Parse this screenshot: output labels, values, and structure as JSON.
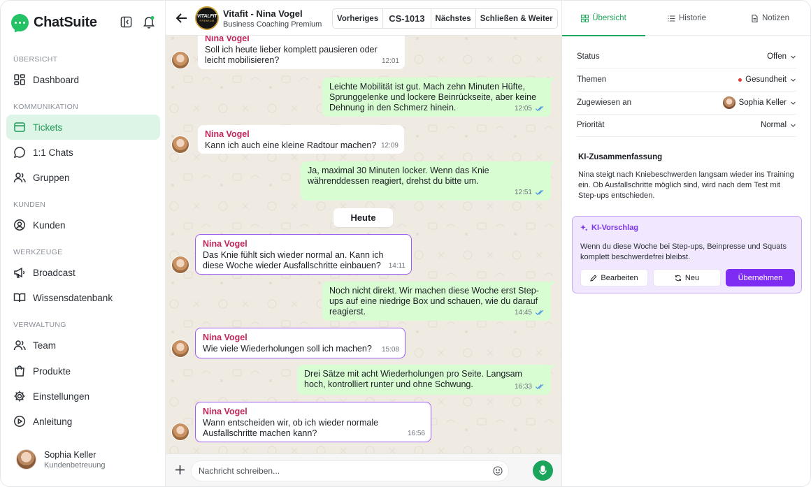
{
  "sidebar": {
    "brand": "ChatSuite",
    "sections": {
      "overview": "ÜBERSICHT",
      "communication": "KOMMUNIKATION",
      "customers": "KUNDEN",
      "tools": "WERKZEUGE",
      "admin": "VERWALTUNG"
    },
    "items": {
      "dashboard": "Dashboard",
      "tickets": "Tickets",
      "chats": "1:1 Chats",
      "groups": "Gruppen",
      "customers": "Kunden",
      "broadcast": "Broadcast",
      "knowledge": "Wissensdatenbank",
      "team": "Team",
      "products": "Produkte",
      "settings": "Einstellungen",
      "guide": "Anleitung"
    },
    "active_item": "tickets",
    "user": {
      "name": "Sophia Keller",
      "role": "Kundenbetreuung"
    }
  },
  "chat": {
    "header": {
      "avatar_line1": "VITALFIT",
      "avatar_line2": "PREMIUM",
      "title": "Vitafit - Nina Vogel",
      "subtitle": "Business Coaching Premium",
      "prev": "Vorheriges",
      "ticket_id": "CS-1013",
      "next": "Nächstes",
      "close_next": "Schließen & Weiter"
    },
    "day_separator": "Heute",
    "messages": [
      {
        "dir": "in",
        "sender": "Nina Vogel",
        "text": "Soll ich heute lieber komplett pausieren oder leicht mobilisieren?",
        "time": "12:01"
      },
      {
        "dir": "out",
        "text": "Leichte Mobilität ist gut. Mach zehn Minuten Hüfte, Sprunggelenke und lockere Beinrückseite, aber keine Dehnung in den Schmerz hinein.",
        "time": "12:05"
      },
      {
        "dir": "in",
        "sender": "Nina Vogel",
        "text": "Kann ich auch eine kleine Radtour machen?",
        "time": "12:09"
      },
      {
        "dir": "out",
        "text": "Ja, maximal 30 Minuten locker. Wenn das Knie währenddessen reagiert, drehst du bitte um.",
        "time": "12:51"
      },
      {
        "dir": "in",
        "sender": "Nina Vogel",
        "text": "Das Knie fühlt sich wieder normal an. Kann ich diese Woche wieder Ausfallschritte einbauen?",
        "time": "14:11"
      },
      {
        "dir": "out",
        "text": "Noch nicht direkt. Wir machen diese Woche erst Step-ups auf eine niedrige Box und schauen, wie du darauf reagierst.",
        "time": "14:45"
      },
      {
        "dir": "in",
        "sender": "Nina Vogel",
        "text": "Wie viele Wiederholungen soll  ich machen?",
        "time": "15:08"
      },
      {
        "dir": "out",
        "text": "Drei Sätze mit acht Wiederholungen pro Seite. Langsam hoch, kontrolliert runter und ohne Schwung.",
        "time": "16:33"
      },
      {
        "dir": "in",
        "sender": "Nina Vogel",
        "text": "Wann entscheiden wir, ob ich wieder normale Ausfallschritte machen kann?",
        "time": "16:56"
      }
    ],
    "composer": {
      "placeholder": "Nachricht schreiben..."
    }
  },
  "panel": {
    "tabs": {
      "overview": "Übersicht",
      "history": "Historie",
      "notes": "Notizen"
    },
    "props": {
      "status_label": "Status",
      "status_value": "Offen",
      "topics_label": "Themen",
      "topics_value": "Gesundheit",
      "assigned_label": "Zugewiesen an",
      "assigned_value": "Sophia Keller",
      "priority_label": "Priorität",
      "priority_value": "Normal"
    },
    "ai_summary": {
      "title": "KI-Zusammenfassung",
      "text": "Nina steigt nach Kniebeschwerden langsam wieder ins Training ein. Ob Ausfallschritte möglich sind, wird nach dem Test mit Step-ups entschieden."
    },
    "ai_suggestion": {
      "title": "KI-Vorschlag",
      "text": "Wenn du diese Woche bei Step-ups, Beinpresse und Squats komplett beschwerdefrei bleibst.",
      "edit": "Bearbeiten",
      "regenerate": "Neu",
      "accept": "Übernehmen"
    }
  },
  "colors": {
    "brand_green": "#25c265",
    "active_nav_bg": "#dcf5e6",
    "outgoing_bubble": "#d9fdd3",
    "sender_name": "#c0265a",
    "ai_purple": "#7e2cf2",
    "chat_bg": "#efeae2"
  }
}
